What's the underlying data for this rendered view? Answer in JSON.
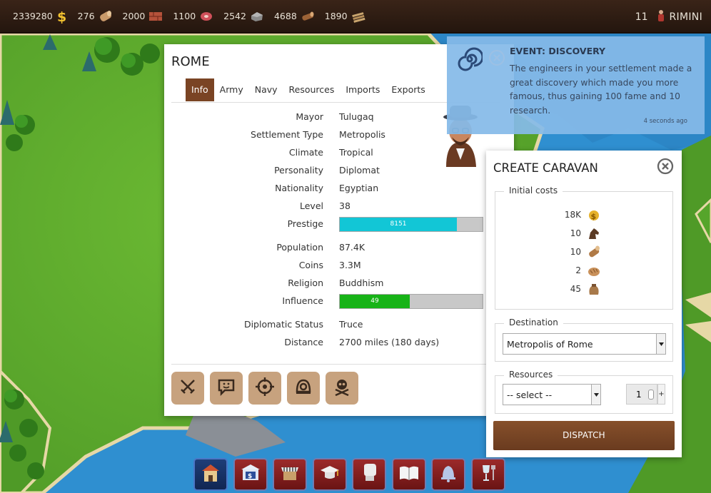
{
  "topbar": {
    "resources": [
      {
        "value": "2339280",
        "icon": "coins-icon"
      },
      {
        "value": "276",
        "icon": "wood-icon"
      },
      {
        "value": "2000",
        "icon": "bricks-icon"
      },
      {
        "value": "1100",
        "icon": "meat-icon"
      },
      {
        "value": "2542",
        "icon": "stone-icon"
      },
      {
        "value": "4688",
        "icon": "logs-icon"
      },
      {
        "value": "1890",
        "icon": "planks-icon"
      }
    ],
    "level": "11",
    "city": "RIMINI"
  },
  "settlement": {
    "title": "ROME",
    "tabs": [
      "Info",
      "Army",
      "Navy",
      "Resources",
      "Imports",
      "Exports"
    ],
    "active_tab": "Info",
    "info": {
      "mayor": {
        "label": "Mayor",
        "value": "Tulugaq"
      },
      "settlement_type": {
        "label": "Settlement Type",
        "value": "Metropolis"
      },
      "climate": {
        "label": "Climate",
        "value": "Tropical"
      },
      "personality": {
        "label": "Personality",
        "value": "Diplomat"
      },
      "nationality": {
        "label": "Nationality",
        "value": "Egyptian"
      },
      "level": {
        "label": "Level",
        "value": "38"
      },
      "prestige": {
        "label": "Prestige",
        "value": "8151",
        "fill_percent": 82,
        "color": "#12c6d6"
      },
      "population": {
        "label": "Population",
        "value": "87.4K"
      },
      "coins": {
        "label": "Coins",
        "value": "3.3M"
      },
      "religion": {
        "label": "Religion",
        "value": "Buddhism"
      },
      "influence": {
        "label": "Influence",
        "value": "49",
        "fill_percent": 49,
        "color": "#17b317"
      },
      "diplomatic_status": {
        "label": "Diplomatic Status",
        "value": "Truce"
      },
      "distance": {
        "label": "Distance",
        "value": "2700 miles (180 days)"
      }
    },
    "actions": [
      "attack-swords-icon",
      "diplomacy-chat-icon",
      "spy-target-icon",
      "helmet-icon",
      "skull-crossbones-icon"
    ]
  },
  "event": {
    "title": "EVENT: DISCOVERY",
    "body": "The engineers in your settlement made a great discovery which made you more famous, thus gaining 100 fame and 10 research.",
    "time": "4 seconds ago",
    "icon": "swirl-icon"
  },
  "caravan": {
    "title": "CREATE CARAVAN",
    "initial_costs_label": "Initial costs",
    "costs": [
      {
        "value": "18K",
        "icon": "coins-icon"
      },
      {
        "value": "10",
        "icon": "horse-icon"
      },
      {
        "value": "10",
        "icon": "wood-icon"
      },
      {
        "value": "2",
        "icon": "bread-icon"
      },
      {
        "value": "45",
        "icon": "sack-icon"
      }
    ],
    "destination_label": "Destination",
    "destination_value": "Metropolis of Rome",
    "resources_label": "Resources",
    "resource_select_value": "-- select --",
    "quantity": "1",
    "plus_label": "+",
    "dispatch_label": "DISPATCH"
  },
  "buildings": [
    "city-hall-icon",
    "bank-icon",
    "market-icon",
    "academy-icon",
    "boxing-icon",
    "library-icon",
    "temple-icon",
    "tavern-icon"
  ],
  "colors": {
    "brand_brown": "#7a4424",
    "panel_white": "#ffffff",
    "event_blue": "#85bae8"
  }
}
